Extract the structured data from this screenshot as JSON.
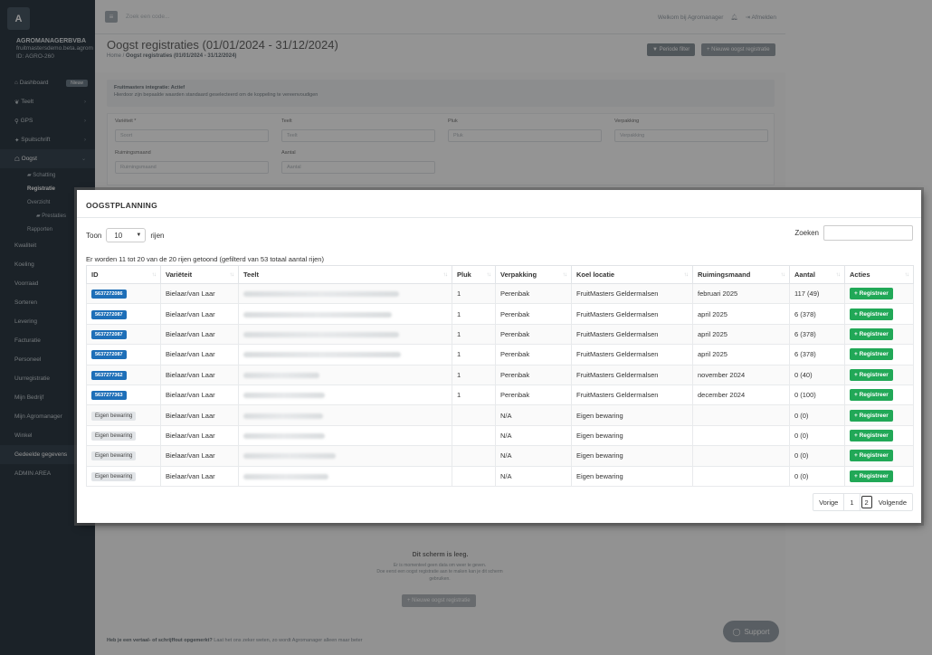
{
  "sidebar": {
    "logo_letter": "A",
    "company_name": "AGROMANAGERBVBA",
    "company_sub": "fruitmastersdemo.beta.agrom",
    "company_id": "ID: AGRO-260",
    "items": [
      {
        "label": "Dashboard",
        "icon": "home-icon",
        "badge": "Nieuw"
      },
      {
        "label": "Teelt",
        "icon": "leaf-icon"
      },
      {
        "label": "GPS",
        "icon": "pin-icon"
      },
      {
        "label": "Spuitschrift",
        "icon": "spray-icon"
      },
      {
        "label": "Oogst",
        "icon": "basket-icon"
      }
    ],
    "sub_items": [
      {
        "label": "Schatting"
      },
      {
        "label": "Registratie"
      },
      {
        "label": "Overzicht"
      },
      {
        "label": "Prestaties"
      },
      {
        "label": "Rapporten"
      }
    ],
    "items2": [
      {
        "label": "Kwaliteit"
      },
      {
        "label": "Koeling"
      },
      {
        "label": "Voorraad"
      },
      {
        "label": "Sorteren"
      },
      {
        "label": "Levering"
      },
      {
        "label": "Facturatie"
      },
      {
        "label": "Personeel"
      },
      {
        "label": "Uurregistratie"
      },
      {
        "label": "Mijn Bedrijf"
      },
      {
        "label": "Mijn Agromanager"
      },
      {
        "label": "Winkel"
      },
      {
        "label": "Gedeelde gegevens"
      },
      {
        "label": "ADMIN AREA"
      }
    ]
  },
  "topbar": {
    "search_placeholder": "Zoek een code...",
    "welcome": "Welkom bij Agromanager",
    "logout": "Afmelden"
  },
  "header": {
    "title": "Oogst registraties (01/01/2024 - 31/12/2024)",
    "crumb_home": "Home",
    "crumb_current": "Oogst registraties (01/01/2024 - 31/12/2024)",
    "filter_btn": "Periode filter",
    "new_btn": "+ Nieuwe oogst registratie"
  },
  "info": {
    "title": "Fruitmasters integratie: Actief",
    "text": "Hierdoor zijn bepaalde waarden standaard geselecteerd om de koppeling te vereenvoudigen"
  },
  "form": {
    "variety_label": "Variëteit *",
    "variety_placeholder": "Soort",
    "teelt_label": "Teelt",
    "teelt_placeholder": "Teelt",
    "pluk_label": "Pluk",
    "pluk_placeholder": "Pluk",
    "verpakking_label": "Verpakking",
    "verpakking_placeholder": "Verpakking",
    "ruiming_label": "Ruimingsmaand",
    "ruiming_placeholder": "Ruimingsmaand",
    "aantal_label": "Aantal",
    "aantal_placeholder": "Aantal"
  },
  "empty": {
    "title": "Dit scherm is leeg.",
    "line1": "Er is momenteel geen data om weer te geven.",
    "line2": "Doe eerst een oogst registratie aan te maken kan je dit scherm",
    "line3": "gebruiken.",
    "button": "+ Nieuwe oogst registratie"
  },
  "footer": {
    "bold": "Heb je een vertaal- of schrijffout opgemerkt?",
    "text": "Laat het ons zeker weten, zo wordt Agromanager alleen maar beter"
  },
  "support": "Support",
  "card": {
    "title": "OOGSTPLANNING",
    "show_label": "Toon",
    "show_value": "10",
    "rows_label": "rijen",
    "search_label": "Zoeken",
    "info_line": "Er worden 11 tot 20 van de 20 rijen getoond (gefilterd van 53 totaal aantal rijen)",
    "columns": [
      "ID",
      "Variëteit",
      "Teelt",
      "Pluk",
      "Verpakking",
      "Koel locatie",
      "Ruimingsmaand",
      "Aantal",
      "Acties"
    ],
    "rows": [
      {
        "id": "5637272086",
        "id_type": "blue",
        "variety": "Bielaar/van Laar",
        "pluk": "1",
        "pack": "Perenbak",
        "koel": "FruitMasters Geldermalsen",
        "month": "februari 2025",
        "count": "117 (49)",
        "action": "+ Registreer"
      },
      {
        "id": "5637272087",
        "id_type": "blue",
        "variety": "Bielaar/van Laar",
        "pluk": "1",
        "pack": "Perenbak",
        "koel": "FruitMasters Geldermalsen",
        "month": "april 2025",
        "count": "6 (378)",
        "action": "+ Registreer"
      },
      {
        "id": "5637272087",
        "id_type": "blue",
        "variety": "Bielaar/van Laar",
        "pluk": "1",
        "pack": "Perenbak",
        "koel": "FruitMasters Geldermalsen",
        "month": "april 2025",
        "count": "6 (378)",
        "action": "+ Registreer"
      },
      {
        "id": "5637272087",
        "id_type": "blue",
        "variety": "Bielaar/van Laar",
        "pluk": "1",
        "pack": "Perenbak",
        "koel": "FruitMasters Geldermalsen",
        "month": "april 2025",
        "count": "6 (378)",
        "action": "+ Registreer"
      },
      {
        "id": "5637277362",
        "id_type": "blue",
        "variety": "Bielaar/van Laar",
        "pluk": "1",
        "pack": "Perenbak",
        "koel": "FruitMasters Geldermalsen",
        "month": "november 2024",
        "count": "0 (40)",
        "action": "+ Registreer"
      },
      {
        "id": "5637277363",
        "id_type": "blue",
        "variety": "Bielaar/van Laar",
        "pluk": "1",
        "pack": "Perenbak",
        "koel": "FruitMasters Geldermalsen",
        "month": "december 2024",
        "count": "0 (100)",
        "action": "+ Registreer"
      },
      {
        "id": "Eigen bewaring",
        "id_type": "grey",
        "variety": "Bielaar/van Laar",
        "pluk": "",
        "pack": "N/A",
        "koel": "Eigen bewaring",
        "month": "",
        "count": "0 (0)",
        "action": "+ Registreer"
      },
      {
        "id": "Eigen bewaring",
        "id_type": "grey",
        "variety": "Bielaar/van Laar",
        "pluk": "",
        "pack": "N/A",
        "koel": "Eigen bewaring",
        "month": "",
        "count": "0 (0)",
        "action": "+ Registreer"
      },
      {
        "id": "Eigen bewaring",
        "id_type": "grey",
        "variety": "Bielaar/van Laar",
        "pluk": "",
        "pack": "N/A",
        "koel": "Eigen bewaring",
        "month": "",
        "count": "0 (0)",
        "action": "+ Registreer"
      },
      {
        "id": "Eigen bewaring",
        "id_type": "grey",
        "variety": "Bielaar/van Laar",
        "pluk": "",
        "pack": "N/A",
        "koel": "Eigen bewaring",
        "month": "",
        "count": "0 (0)",
        "action": "+ Registreer"
      }
    ],
    "pager": {
      "prev": "Vorige",
      "p1": "1",
      "p2": "2",
      "next": "Volgende"
    }
  },
  "colors": {
    "sidebar": "#2f3b45",
    "id_badge": "#1e6fb8",
    "register": "#21a857"
  }
}
